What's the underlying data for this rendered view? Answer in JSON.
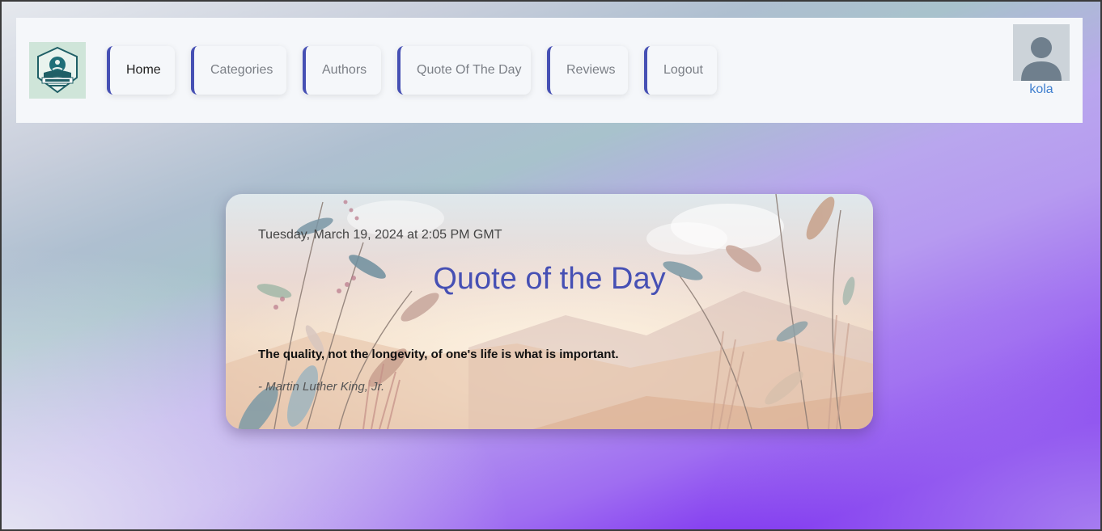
{
  "navbar": {
    "logo_icon": "inspire-logo",
    "items": [
      {
        "label": "Home",
        "active": true
      },
      {
        "label": "Categories",
        "active": false
      },
      {
        "label": "Authors",
        "active": false
      },
      {
        "label": "Quote Of The Day",
        "active": false
      },
      {
        "label": "Reviews",
        "active": false
      },
      {
        "label": "Logout",
        "active": false
      }
    ],
    "user": {
      "avatar_icon": "user-avatar-icon",
      "name": "kola"
    }
  },
  "quote_card": {
    "date": "Tuesday, March 19, 2024 at 2:05 PM GMT",
    "title": "Quote of the Day",
    "quote": "The quality, not the longevity, of one's life is what is important.",
    "author": "- Martin Luther King, Jr."
  },
  "colors": {
    "accent": "#4650b4",
    "username": "#3f7fcf",
    "navbar_bg": "#f5f7fa"
  }
}
